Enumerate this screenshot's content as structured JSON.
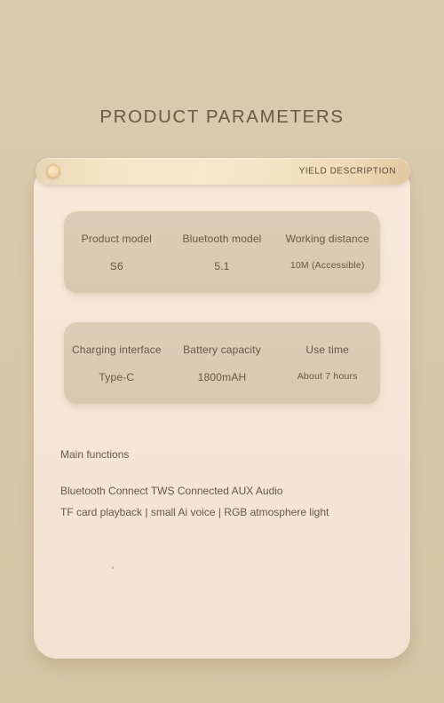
{
  "page": {
    "title": "PRODUCT PARAMETERS",
    "background_color": "#d9c8ad",
    "panel_color": "#f5e5d6",
    "card_color": "#d9c9b2",
    "text_color": "#6b5542",
    "title_color": "#6e5640",
    "accent_color": "#f5e0bc"
  },
  "header": {
    "label": "YIELD DESCRIPTION",
    "knob_icon": "circle-knob-icon"
  },
  "spec_cards": [
    {
      "columns": [
        {
          "label": "Product model",
          "value": "S6"
        },
        {
          "label": "Bluetooth model",
          "value": "5.1"
        },
        {
          "label": "Working distance",
          "value": "10M (Accessible)"
        }
      ]
    },
    {
      "columns": [
        {
          "label": "Charging interface",
          "value": "Type-C"
        },
        {
          "label": "Battery capacity",
          "value": "1800mAH"
        },
        {
          "label": "Use time",
          "value": "About 7 hours"
        }
      ]
    }
  ],
  "functions": {
    "heading": "Main functions",
    "lines": [
      "Bluetooth Connect TWS Connected AUX Audio",
      "TF card playback | small Ai voice | RGB atmosphere light"
    ]
  }
}
